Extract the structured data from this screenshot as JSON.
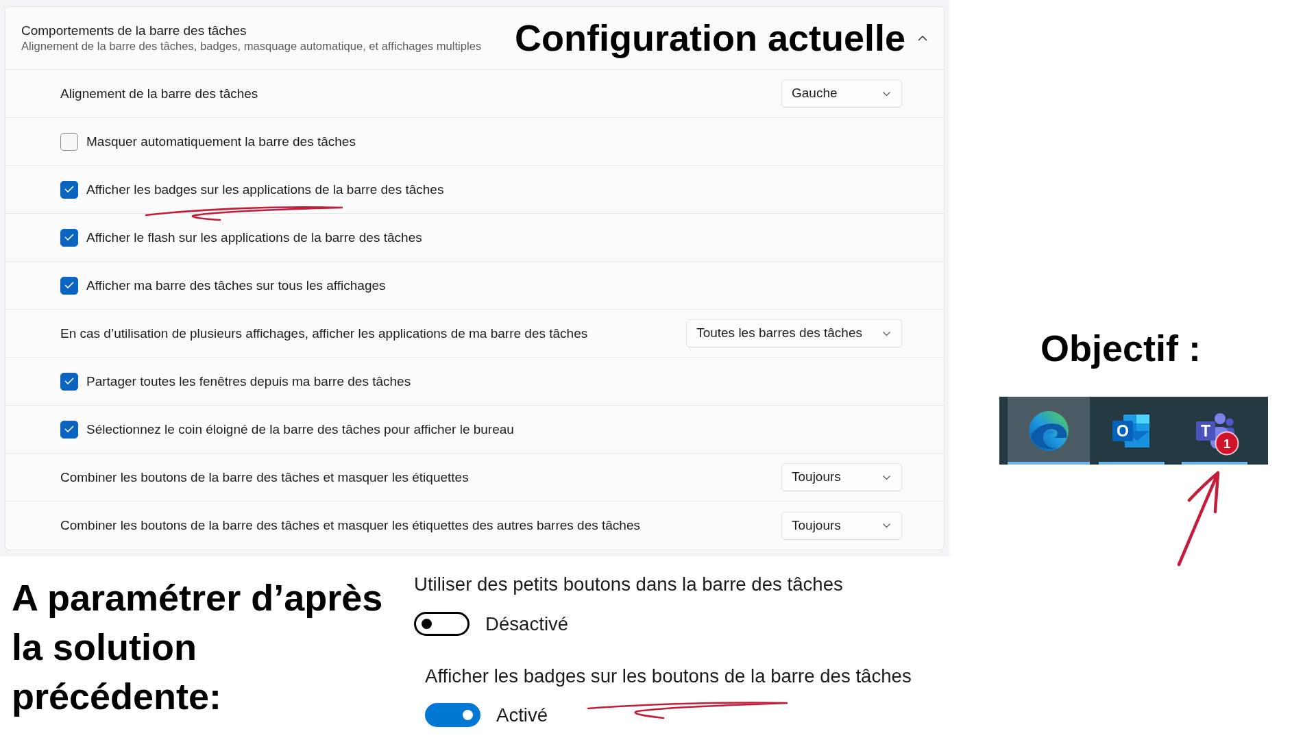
{
  "current_settings": {
    "heading": "Configuration actuelle",
    "section": {
      "title": "Comportements de la barre des tâches",
      "subtitle": "Alignement de la barre des tâches, badges, masquage automatique, et affichages multiples",
      "expanded": true
    },
    "rows": [
      {
        "kind": "dropdown",
        "label": "Alignement de la barre des tâches",
        "value": "Gauche",
        "annotated": false
      },
      {
        "kind": "checkbox",
        "label": "Masquer automatiquement la barre des tâches",
        "checked": false,
        "annotated": false
      },
      {
        "kind": "checkbox",
        "label": "Afficher les badges sur les applications de la barre des tâches",
        "checked": true,
        "annotated": true
      },
      {
        "kind": "checkbox",
        "label": "Afficher le flash sur les applications de la barre des tâches",
        "checked": true,
        "annotated": false
      },
      {
        "kind": "checkbox",
        "label": "Afficher ma barre des tâches sur tous les affichages",
        "checked": true,
        "annotated": false
      },
      {
        "kind": "dropdown",
        "label": "En cas d’utilisation de plusieurs affichages, afficher les applications de ma barre des tâches",
        "value": "Toutes les barres des tâches",
        "annotated": false
      },
      {
        "kind": "checkbox",
        "label": "Partager toutes les fenêtres depuis ma barre des tâches",
        "checked": true,
        "annotated": false
      },
      {
        "kind": "checkbox",
        "label": "Sélectionnez le coin éloigné de la barre des tâches pour afficher le bureau",
        "checked": true,
        "annotated": false
      },
      {
        "kind": "dropdown",
        "label": "Combiner les boutons de la barre des tâches et masquer les étiquettes",
        "value": "Toujours",
        "annotated": false
      },
      {
        "kind": "dropdown",
        "label": "Combiner les boutons de la barre des tâches et masquer les étiquettes des autres barres des tâches",
        "value": "Toujours",
        "annotated": false
      }
    ]
  },
  "goal": {
    "heading": "Objectif :",
    "taskbar": [
      {
        "selected": true
      },
      {
        "selected": false,
        "logo_letter": "O"
      },
      {
        "selected": false,
        "logo_letter": "T",
        "badge": "1"
      }
    ]
  },
  "to_configure": {
    "heading": "A paramétrer d’après la solution précédente:",
    "toggles": [
      {
        "label": "Utiliser des petits boutons dans la barre des tâches",
        "on": false,
        "state_text": "Désactivé",
        "annotated": false
      },
      {
        "label": "Afficher les badges sur les boutons de la barre des tâches",
        "on": true,
        "state_text": "Activé",
        "annotated": true
      }
    ]
  }
}
